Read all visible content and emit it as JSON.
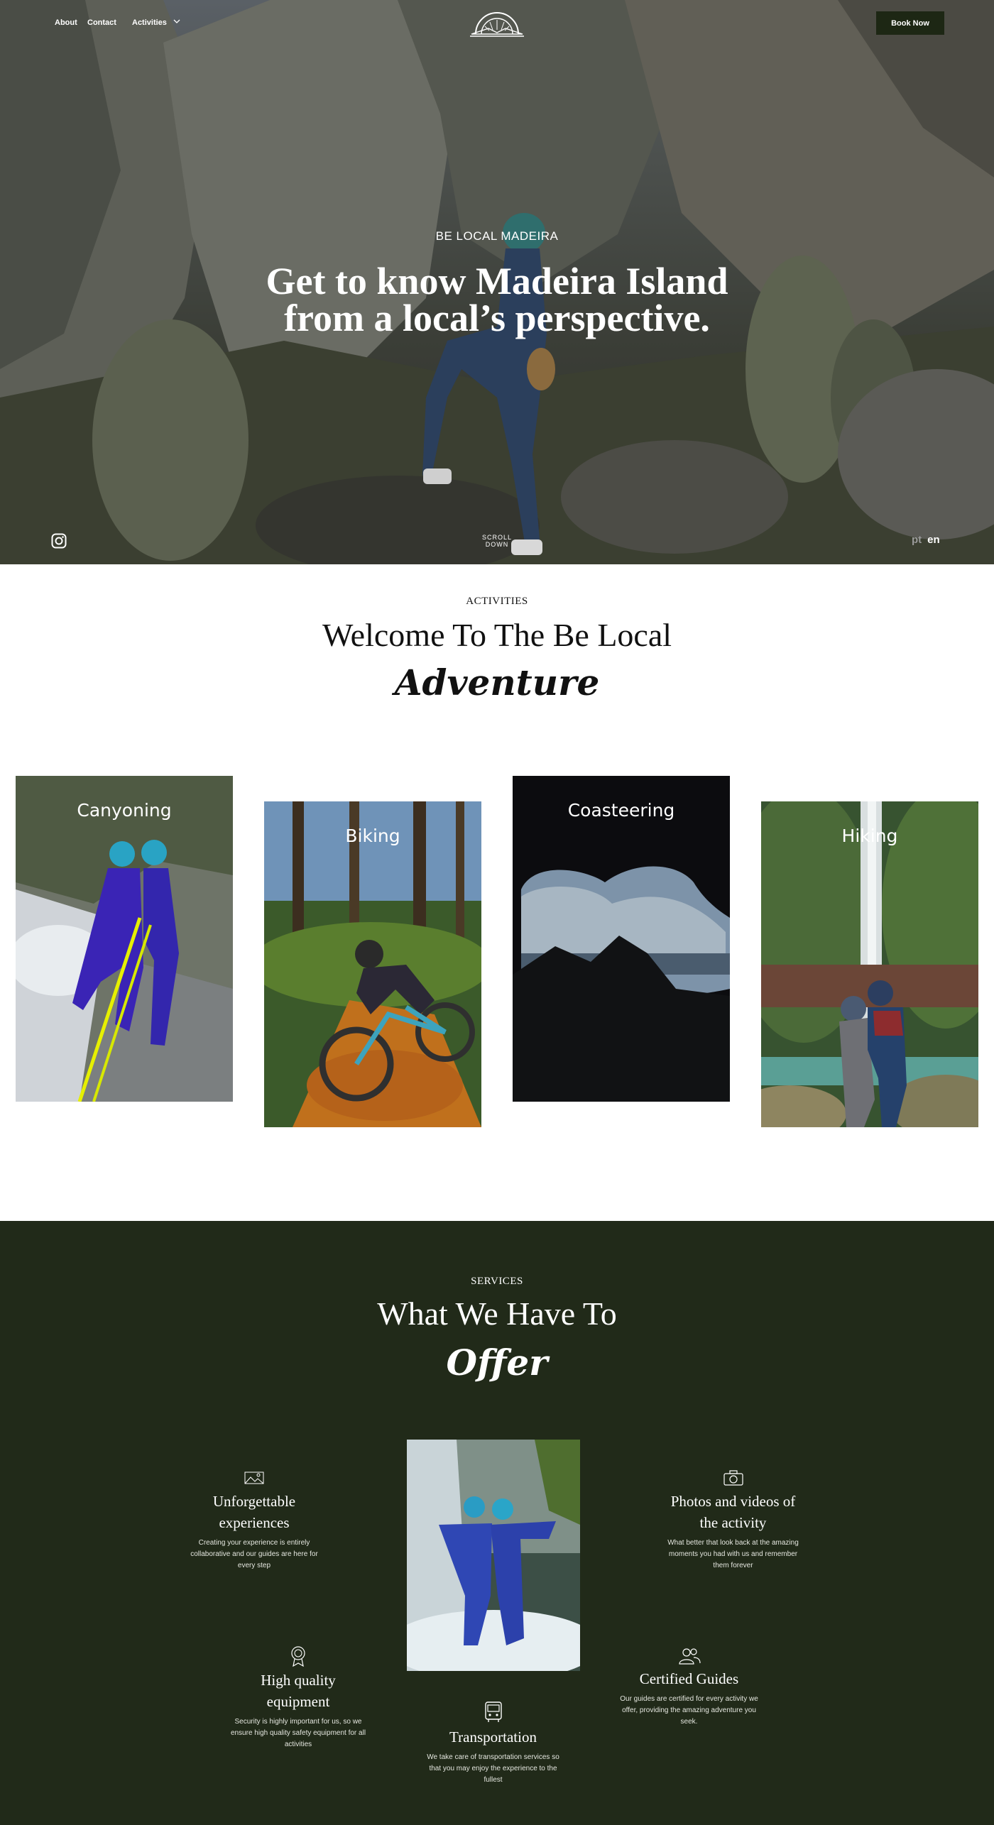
{
  "nav": {
    "about": "About",
    "contact": "Contact",
    "activities": "Activities",
    "book_now": "Book Now"
  },
  "hero": {
    "kicker": "BE LOCAL MADEIRA",
    "title_line1": "Get to know Madeira Island",
    "title_line2": "from a local’s perspective.",
    "scroll_line1": "SCROLL",
    "scroll_line2": "DOWN",
    "lang_pt": "pt",
    "lang_en": "en"
  },
  "activities": {
    "kicker": "ACTIVITIES",
    "title": "Welcome To The Be Local",
    "script": "Adventure",
    "cards": [
      {
        "label": "Canyoning"
      },
      {
        "label": "Biking"
      },
      {
        "label": "Coasteering"
      },
      {
        "label": "Hiking"
      }
    ]
  },
  "services": {
    "kicker": "SERVICES",
    "title": "What We Have To",
    "script": "Offer",
    "items": [
      {
        "icon": "landscape-icon",
        "title_line1": "Unforgettable",
        "title_line2": "experiences",
        "text": "Creating your experience is entirely collaborative and our guides are here for every step"
      },
      {
        "icon": "camera-icon",
        "title_line1": "Photos and videos of",
        "title_line2": "the activity",
        "text": "What better that look back at the amazing moments you had with us and remember them forever"
      },
      {
        "icon": "award-icon",
        "title_line1": "High quality",
        "title_line2": "equipment",
        "text": "Security is highly important for us, so we ensure high quality safety equipment for all activities"
      },
      {
        "icon": "users-icon",
        "title_line1": "Certified Guides",
        "title_line2": "",
        "text": "Our guides are certified for every activity we offer, providing the amazing adventure you seek."
      },
      {
        "icon": "bus-icon",
        "title_line1": "Transportation",
        "title_line2": "",
        "text": "We take care of transportation services so that you may enjoy the experience to the fullest"
      }
    ]
  },
  "colors": {
    "dark_green": "#212a19",
    "button": "#1d2714"
  }
}
